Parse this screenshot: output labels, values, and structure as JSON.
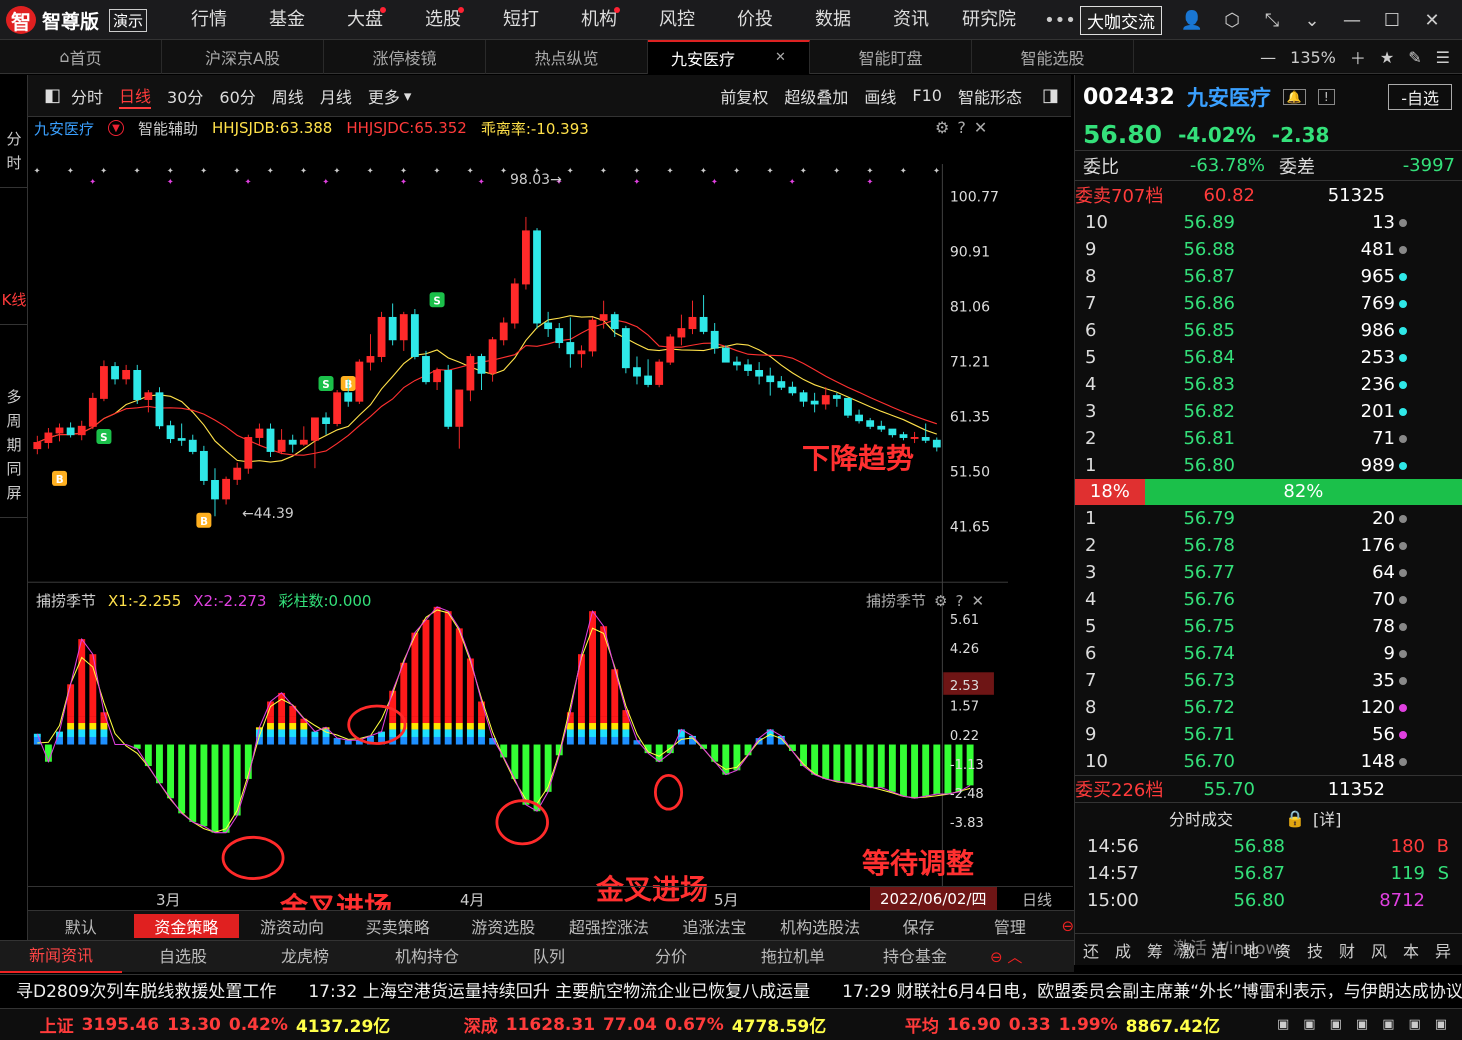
{
  "app": {
    "name": "智尊版",
    "demo": "演示",
    "vip": "大咖交流"
  },
  "menu": [
    {
      "label": "行情",
      "dot": false
    },
    {
      "label": "基金",
      "dot": false
    },
    {
      "label": "大盘",
      "dot": true
    },
    {
      "label": "选股",
      "dot": true
    },
    {
      "label": "短打",
      "dot": false
    },
    {
      "label": "机构",
      "dot": true
    },
    {
      "label": "风控",
      "dot": false
    },
    {
      "label": "价投",
      "dot": false
    },
    {
      "label": "数据",
      "dot": false
    },
    {
      "label": "资讯",
      "dot": false
    },
    {
      "label": "研究院",
      "dot": false
    }
  ],
  "tabs": [
    {
      "label": "首页"
    },
    {
      "label": "沪深京A股"
    },
    {
      "label": "涨停棱镜"
    },
    {
      "label": "热点纵览"
    },
    {
      "label": "九安医疗",
      "active": true
    },
    {
      "label": "智能盯盘"
    },
    {
      "label": "智能选股"
    }
  ],
  "zoom": "135%",
  "left_modes": [
    "分时",
    "K线",
    "多周期同屏"
  ],
  "toolbar": {
    "periods": [
      "分时",
      "日线",
      "30分",
      "60分",
      "周线",
      "月线",
      "更多"
    ],
    "active": "日线",
    "right": [
      "前复权",
      "超级叠加",
      "画线",
      "F10",
      "智能形态"
    ]
  },
  "indicator": {
    "name": "九安医疗",
    "assist": "智能辅助",
    "jdb": "HHJSJDB:63.388",
    "jdc": "HHJSJDC:65.352",
    "deviation": "乖离率:-10.393"
  },
  "price_axis": [
    "100.77",
    "90.91",
    "81.06",
    "71.21",
    "61.35",
    "51.50",
    "41.65"
  ],
  "high_label": "98.03",
  "low_label": "44.39",
  "annotations": {
    "down": "下降趋势",
    "cross1": "金叉进场",
    "cross2": "金叉进场",
    "wait": "等待调整"
  },
  "sub": {
    "name": "捕捞季节",
    "x1": "X1:-2.255",
    "x2": "X2:-2.273",
    "bars": "彩柱数:0.000",
    "axis": [
      "5.61",
      "4.26",
      "2.53",
      "1.57",
      "0.22",
      "-1.13",
      "-2.48",
      "-3.83"
    ],
    "current": "2.53"
  },
  "months": [
    "3月",
    "4月",
    "5月"
  ],
  "date": "2022/06/02/四",
  "period_tag": "日线",
  "strategies": [
    "默认",
    "资金策略",
    "游资动向",
    "买卖策略",
    "游资选股",
    "超强控涨法",
    "追涨法宝",
    "机构选股法",
    "保存",
    "管理"
  ],
  "bottom_tabs": [
    "新闻资讯",
    "自选股",
    "龙虎榜",
    "机构持仓",
    "队列",
    "分价",
    "拖拉机单",
    "持仓基金"
  ],
  "quote": {
    "code": "002432",
    "name": "九安医疗",
    "price": "56.80",
    "pct": "-4.02%",
    "chg": "-2.38",
    "btn": "-自选",
    "wb_label": "委比",
    "wb": "-63.78%",
    "wc_label": "委差",
    "wc": "-3997",
    "sell_total_label": "委卖707档",
    "sell_total_price": "60.82",
    "sell_total_vol": "51325",
    "buy_total_label": "委买226档",
    "buy_total_price": "55.70",
    "buy_total_vol": "11352",
    "ratio_sell": "18%",
    "ratio_buy": "82%"
  },
  "asks": [
    {
      "lv": "10",
      "p": "56.89",
      "v": "13",
      "c": "#888"
    },
    {
      "lv": "9",
      "p": "56.88",
      "v": "481",
      "c": "#888"
    },
    {
      "lv": "8",
      "p": "56.87",
      "v": "965",
      "c": "#2fe8e8"
    },
    {
      "lv": "7",
      "p": "56.86",
      "v": "769",
      "c": "#2fe8e8"
    },
    {
      "lv": "6",
      "p": "56.85",
      "v": "986",
      "c": "#2fe8e8"
    },
    {
      "lv": "5",
      "p": "56.84",
      "v": "253",
      "c": "#2fe8e8"
    },
    {
      "lv": "4",
      "p": "56.83",
      "v": "236",
      "c": "#2fe8e8"
    },
    {
      "lv": "3",
      "p": "56.82",
      "v": "201",
      "c": "#2fe8e8"
    },
    {
      "lv": "2",
      "p": "56.81",
      "v": "71",
      "c": "#888"
    },
    {
      "lv": "1",
      "p": "56.80",
      "v": "989",
      "c": "#2fe8e8"
    }
  ],
  "bids": [
    {
      "lv": "1",
      "p": "56.79",
      "v": "20",
      "c": "#888"
    },
    {
      "lv": "2",
      "p": "56.78",
      "v": "176",
      "c": "#888"
    },
    {
      "lv": "3",
      "p": "56.77",
      "v": "64",
      "c": "#888"
    },
    {
      "lv": "4",
      "p": "56.76",
      "v": "70",
      "c": "#888"
    },
    {
      "lv": "5",
      "p": "56.75",
      "v": "78",
      "c": "#888"
    },
    {
      "lv": "6",
      "p": "56.74",
      "v": "9",
      "c": "#888"
    },
    {
      "lv": "7",
      "p": "56.73",
      "v": "35",
      "c": "#888"
    },
    {
      "lv": "8",
      "p": "56.72",
      "v": "120",
      "c": "#e040e0"
    },
    {
      "lv": "9",
      "p": "56.71",
      "v": "56",
      "c": "#e040e0"
    },
    {
      "lv": "10",
      "p": "56.70",
      "v": "148",
      "c": "#888"
    }
  ],
  "trades_title": "分时成交",
  "trades_detail": "[详]",
  "trades": [
    {
      "t": "14:56",
      "p": "56.88",
      "v": "180",
      "s": "B",
      "c": "#ff3b3b"
    },
    {
      "t": "14:57",
      "p": "56.87",
      "v": "119",
      "s": "S",
      "c": "#34e07a"
    },
    {
      "t": "15:00",
      "p": "56.80",
      "v": "8712",
      "s": "",
      "c": "#e040e0"
    }
  ],
  "side_tabs": [
    "还",
    "成",
    "筹",
    "激",
    "活",
    "地",
    "资",
    "技",
    "财",
    "风",
    "本",
    "异"
  ],
  "watermark": "激活 Windows",
  "news": [
    "寻D2809次列车脱线救援处置工作",
    "17:32 上海空港货运量持续回升 主要航空物流企业已恢复八成运量",
    "17:29 财联社6月4日电，欧盟委员会副主席兼“外长”博雷利表示，与伊朗达成协议"
  ],
  "status": [
    {
      "name": "上证",
      "v": "3195.46",
      "c": "13.30",
      "p": "0.42%",
      "a": "4137.29亿"
    },
    {
      "name": "深成",
      "v": "11628.31",
      "c": "77.04",
      "p": "0.67%",
      "a": "4778.59亿"
    },
    {
      "name": "平均",
      "v": "16.90",
      "c": "0.33",
      "p": "1.99%",
      "a": "8867.42亿"
    }
  ],
  "chart_data": {
    "type": "candlestick",
    "ylim": [
      41.65,
      100.77
    ],
    "candles": [
      [
        56.5,
        58.8,
        55.5,
        57.6
      ],
      [
        57.6,
        60.2,
        56.5,
        59.3
      ],
      [
        59.3,
        61.0,
        57.8,
        60.2
      ],
      [
        60.2,
        61.2,
        58.5,
        59.0
      ],
      [
        59.0,
        61.5,
        58.0,
        60.5
      ],
      [
        60.5,
        66.5,
        60.0,
        65.5
      ],
      [
        65.5,
        72.3,
        65.0,
        71.2
      ],
      [
        71.2,
        72.0,
        68.0,
        69.0
      ],
      [
        69.0,
        71.5,
        68.0,
        70.5
      ],
      [
        70.5,
        71.5,
        64.5,
        65.3
      ],
      [
        65.3,
        67.0,
        63.0,
        66.5
      ],
      [
        66.5,
        67.5,
        60.0,
        60.6
      ],
      [
        60.6,
        61.5,
        57.5,
        58.3
      ],
      [
        58.3,
        61.0,
        57.0,
        58.0
      ],
      [
        58.0,
        59.0,
        55.5,
        56.0
      ],
      [
        56.0,
        57.0,
        50.0,
        50.8
      ],
      [
        50.8,
        53.0,
        44.4,
        47.5
      ],
      [
        47.5,
        51.5,
        46.5,
        51.0
      ],
      [
        51.0,
        54.0,
        50.0,
        53.0
      ],
      [
        53.0,
        59.0,
        52.0,
        58.5
      ],
      [
        58.5,
        61.0,
        57.0,
        60.0
      ],
      [
        60.0,
        61.0,
        55.0,
        56.0
      ],
      [
        56.0,
        60.0,
        55.5,
        58.0
      ],
      [
        58.0,
        59.0,
        55.8,
        57.3
      ],
      [
        57.3,
        60.5,
        57.0,
        58.0
      ],
      [
        58.0,
        62.0,
        53.0,
        62.0
      ],
      [
        62.0,
        63.0,
        59.0,
        61.0
      ],
      [
        61.0,
        67.0,
        60.5,
        66.5
      ],
      [
        66.5,
        69.0,
        64.0,
        65.0
      ],
      [
        65.0,
        72.5,
        64.5,
        72.0
      ],
      [
        72.0,
        77.0,
        70.5,
        73.0
      ],
      [
        73.0,
        81.0,
        72.0,
        80.0
      ],
      [
        80.0,
        82.5,
        75.0,
        76.0
      ],
      [
        76.0,
        81.0,
        74.0,
        80.5
      ],
      [
        80.5,
        81.5,
        72.5,
        73.0
      ],
      [
        73.0,
        74.0,
        68.0,
        68.5
      ],
      [
        68.5,
        71.0,
        67.0,
        70.5
      ],
      [
        70.5,
        71.5,
        60.0,
        60.5
      ],
      [
        60.5,
        63.5,
        56.5,
        67.0
      ],
      [
        67.0,
        73.5,
        65.0,
        73.0
      ],
      [
        73.0,
        73.5,
        67.0,
        70.0
      ],
      [
        70.0,
        76.5,
        68.5,
        76.0
      ],
      [
        76.0,
        80.0,
        75.0,
        79.0
      ],
      [
        79.0,
        87.0,
        78.0,
        86.0
      ],
      [
        86.0,
        98.0,
        85.0,
        95.5
      ],
      [
        95.5,
        96.0,
        78.0,
        79.0
      ],
      [
        79.0,
        81.0,
        76.5,
        78.0
      ],
      [
        78.0,
        79.0,
        74.5,
        75.5
      ],
      [
        75.5,
        80.0,
        71.0,
        73.5
      ],
      [
        73.5,
        75.0,
        71.0,
        74.0
      ],
      [
        74.0,
        80.0,
        73.0,
        79.5
      ],
      [
        79.5,
        83.0,
        78.0,
        80.5
      ],
      [
        80.5,
        81.0,
        76.5,
        78.0
      ],
      [
        78.0,
        78.5,
        70.0,
        71.0
      ],
      [
        71.0,
        73.0,
        68.0,
        69.5
      ],
      [
        69.5,
        72.5,
        67.5,
        68.0
      ],
      [
        68.0,
        72.5,
        67.5,
        72.0
      ],
      [
        72.0,
        77.0,
        71.5,
        76.5
      ],
      [
        76.5,
        80.5,
        75.0,
        78.0
      ],
      [
        78.0,
        83.0,
        77.0,
        80.0
      ],
      [
        80.0,
        84.0,
        77.0,
        77.5
      ],
      [
        77.5,
        79.0,
        73.5,
        74.5
      ],
      [
        74.5,
        75.0,
        72.0,
        72.0
      ],
      [
        72.0,
        73.0,
        70.5,
        71.5
      ],
      [
        71.5,
        72.5,
        69.5,
        70.5
      ],
      [
        70.5,
        72.0,
        68.0,
        69.5
      ],
      [
        69.5,
        71.0,
        66.0,
        68.5
      ],
      [
        68.5,
        69.5,
        67.0,
        67.5
      ],
      [
        67.5,
        68.5,
        66.0,
        66.5
      ],
      [
        66.5,
        67.0,
        64.0,
        65.0
      ],
      [
        65.0,
        66.5,
        63.0,
        64.5
      ],
      [
        64.5,
        67.5,
        63.5,
        66.0
      ],
      [
        66.0,
        66.5,
        64.0,
        65.5
      ],
      [
        65.5,
        65.5,
        62.0,
        62.5
      ],
      [
        62.5,
        63.5,
        61.0,
        61.5
      ],
      [
        61.5,
        62.0,
        60.0,
        60.5
      ],
      [
        60.5,
        61.5,
        59.5,
        60.0
      ],
      [
        60.0,
        60.0,
        58.5,
        59.0
      ],
      [
        59.0,
        59.5,
        58.0,
        58.5
      ],
      [
        58.5,
        59.5,
        57.5,
        58.5
      ],
      [
        58.5,
        61.0,
        57.5,
        58.0
      ],
      [
        58.0,
        58.5,
        56.0,
        56.8
      ]
    ],
    "macd": [
      0.5,
      -0.8,
      0.6,
      2.8,
      4.9,
      4.2,
      1.5,
      0,
      0,
      -0.2,
      -1.0,
      -1.8,
      -2.5,
      -3.2,
      -3.6,
      -3.8,
      -4.1,
      -4.1,
      -3.3,
      -1.6,
      0.8,
      2.0,
      2.4,
      1.8,
      1.2,
      0.6,
      0.8,
      0.3,
      0.2,
      0.2,
      0.4,
      0.6,
      2.5,
      3.8,
      5.2,
      5.8,
      6.4,
      6.2,
      5.4,
      4.0,
      2.0,
      0.3,
      -0.6,
      -1.6,
      -2.8,
      -3.1,
      -2.2,
      -0.5,
      1.5,
      4.2,
      6.2,
      5.5,
      3.5,
      1.6,
      0.2,
      -0.4,
      -0.8,
      -0.4,
      0.7,
      0.4,
      -0.2,
      -0.8,
      -1.4,
      -1.2,
      -0.5,
      0.3,
      0.7,
      0.4,
      -0.3,
      -1.0,
      -1.4,
      -1.6,
      -1.7,
      -1.8,
      -1.8,
      -2.0,
      -2.0,
      -2.2,
      -2.4,
      -2.5,
      -2.4,
      -2.3,
      -2.3,
      -2.2,
      -1.9
    ]
  }
}
